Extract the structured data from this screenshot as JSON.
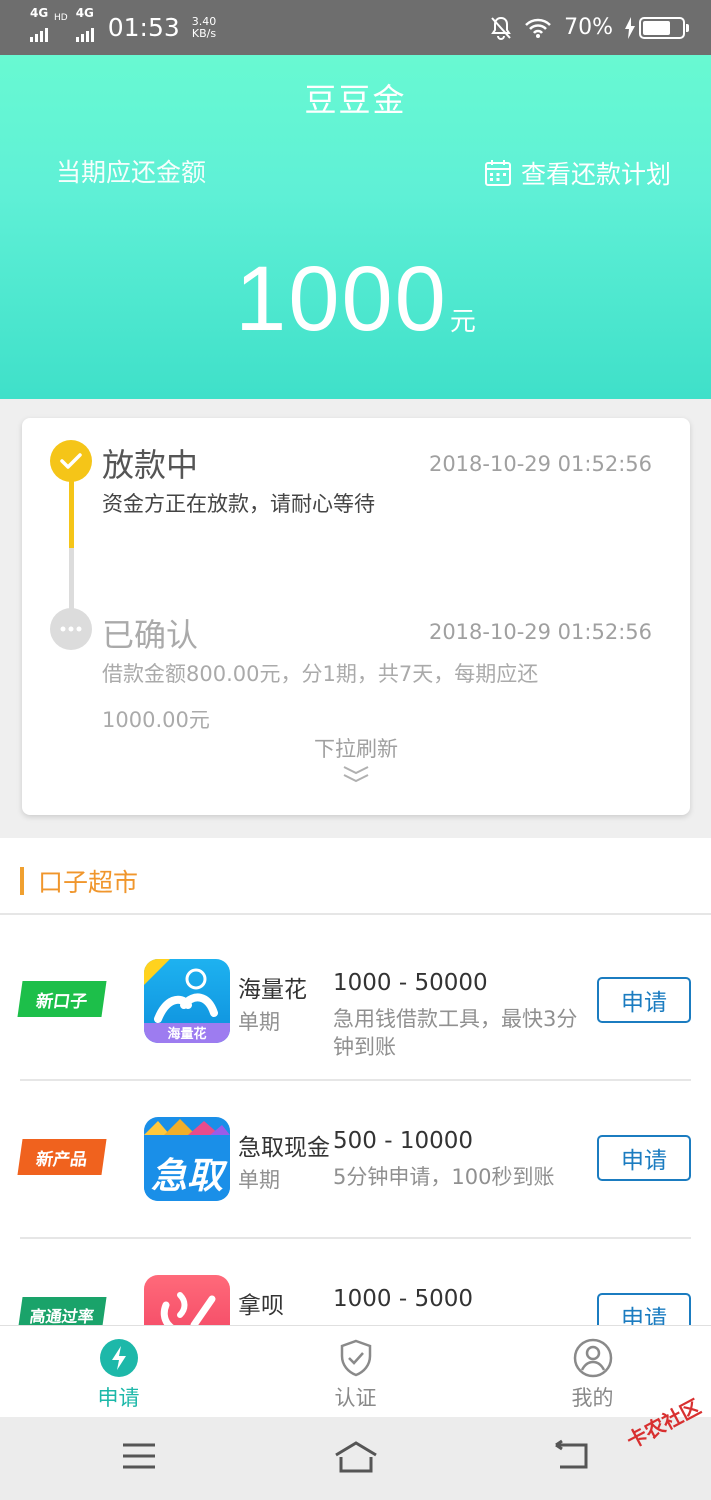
{
  "status_bar": {
    "network1": "4G",
    "network1_sup": "HD",
    "network2": "4G",
    "time": "01:53",
    "speed_value": "3.40",
    "speed_unit": "KB/s",
    "battery_percent": "70%",
    "battery_level": 0.7,
    "icons": [
      "signal-icon",
      "bell-off-icon",
      "wifi-icon",
      "charging-icon",
      "battery-icon"
    ]
  },
  "header": {
    "app_title": "豆豆金",
    "due_label": "当期应还金额",
    "plan_link": "查看还款计划",
    "amount": "1000",
    "amount_unit": "元",
    "gradient_colors": [
      "#68f9d2",
      "#3fe0c9"
    ]
  },
  "status_card": {
    "steps": [
      {
        "title": "放款中",
        "time": "2018-10-29 01:52:56",
        "desc": "资金方正在放款，请耐心等待",
        "state": "active"
      },
      {
        "title": "已确认",
        "time": "2018-10-29 01:52:56",
        "desc_line1": "借款金额800.00元，分1期，共7天，每期应还",
        "desc_line2": "1000.00元",
        "state": "pending"
      }
    ],
    "refresh_hint": "下拉刷新",
    "active_color": "#f5c518",
    "pending_color": "#dcdcdc"
  },
  "market": {
    "title": "口子超市",
    "apply_label": "申请",
    "products": [
      {
        "tag": "新口子",
        "tag_color": "#1dbf4a",
        "logo_text": "海量花",
        "name": "海量花",
        "type": "单期",
        "range": "1000 - 50000",
        "desc": "急用钱借款工具，最快3分钟到账"
      },
      {
        "tag": "新产品",
        "tag_color": "#f0621e",
        "logo_text": "急取",
        "name": "急取现金",
        "type": "单期",
        "range": "500 - 10000",
        "desc": "5分钟申请，100秒到账"
      },
      {
        "tag": "高通过率",
        "tag_color": "#1aa36a",
        "logo_text": "",
        "name": "拿呗",
        "type": "",
        "range": "1000 - 5000",
        "desc": ""
      }
    ]
  },
  "tabbar": {
    "tabs": [
      {
        "label": "申请",
        "icon": "bolt-icon",
        "active": true
      },
      {
        "label": "认证",
        "icon": "shield-check-icon",
        "active": false
      },
      {
        "label": "我的",
        "icon": "user-icon",
        "active": false
      }
    ],
    "active_color": "#1db8a9"
  },
  "navbar": {
    "icons": [
      "menu-icon",
      "home-icon",
      "back-icon"
    ]
  },
  "watermark": "卡农社区"
}
